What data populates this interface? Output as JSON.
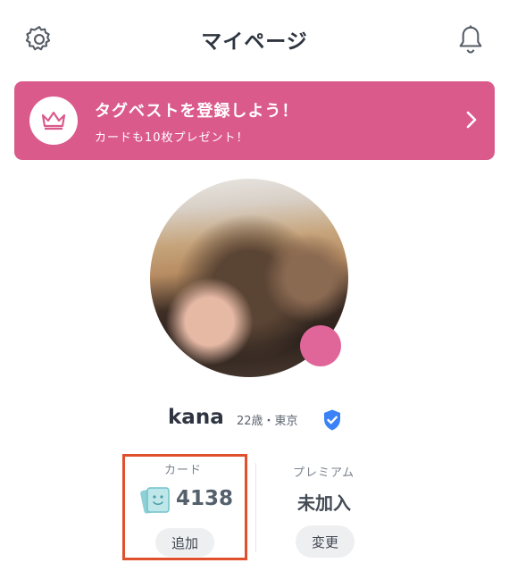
{
  "header": {
    "title": "マイページ",
    "left_icon": "gear-icon",
    "right_icon": "bell-icon"
  },
  "banner": {
    "title": "タグベストを登録しよう！",
    "subtitle": "カードも10枚プレゼント！",
    "icon": "crown-icon",
    "color": "#db5a8c"
  },
  "profile": {
    "name": "kana",
    "meta": "22歳・東京",
    "verified_icon": "verified-shield-icon"
  },
  "stats": {
    "card": {
      "label": "カード",
      "count": "4138",
      "button": "追加"
    },
    "premium": {
      "label": "プレミアム",
      "status": "未加入",
      "button": "変更"
    }
  },
  "colors": {
    "accent": "#db5a8c",
    "highlight_border": "#e0502c",
    "verified": "#3b82f6"
  }
}
